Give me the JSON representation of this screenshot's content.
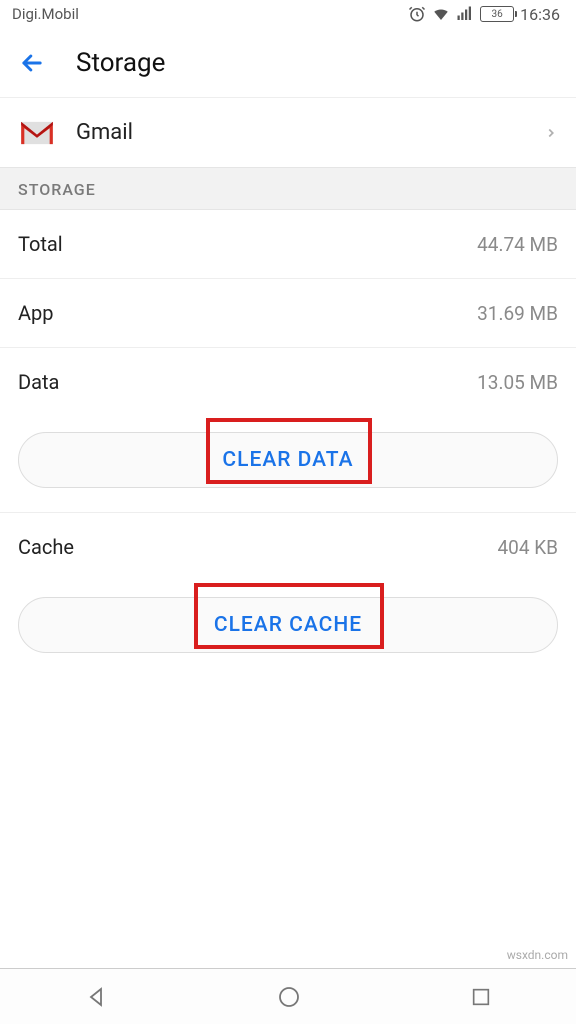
{
  "statusbar": {
    "carrier": "Digi.Mobil",
    "battery_pct": "36",
    "time": "16:36"
  },
  "header": {
    "title": "Storage"
  },
  "app": {
    "name": "Gmail"
  },
  "section": {
    "storage_label": "STORAGE"
  },
  "stats": {
    "total_label": "Total",
    "total_value": "44.74 MB",
    "app_label": "App",
    "app_value": "31.69 MB",
    "data_label": "Data",
    "data_value": "13.05 MB",
    "cache_label": "Cache",
    "cache_value": "404 KB"
  },
  "buttons": {
    "clear_data": "CLEAR DATA",
    "clear_cache": "CLEAR CACHE"
  },
  "watermark": "wsxdn.com"
}
